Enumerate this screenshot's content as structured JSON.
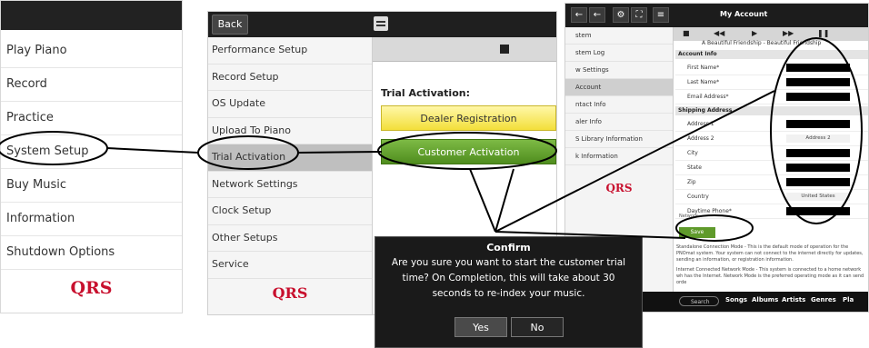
{
  "panel1": {
    "menu": [
      "Play Piano",
      "Record",
      "Practice",
      "System Setup",
      "Buy Music",
      "Information",
      "Shutdown Options"
    ],
    "logo": "QRS"
  },
  "panel2": {
    "back_label": "Back",
    "sidebar": [
      "Performance Setup",
      "Record Setup",
      "OS Update",
      "Upload To Piano",
      "Trial Activation",
      "Network Settings",
      "Clock Setup",
      "Other Setups",
      "Service"
    ],
    "logo": "QRS",
    "heading": "Trial Activation:",
    "dealer_button": "Dealer Registration",
    "customer_button": "Customer Activation"
  },
  "dialog": {
    "title": "Confirm",
    "message": "Are you sure you want to start the customer trial time? On Completion, this will take about 30 seconds to re-index your music.",
    "yes": "Yes",
    "no": "No"
  },
  "panel3": {
    "title": "My Account",
    "song": "A Beautiful Friendship - Beautiful Friendship",
    "sidebar": [
      "stem",
      "stem Log",
      "w Settings",
      "Account",
      "ntact Info",
      "aler Info",
      "S Library Information",
      "k Information"
    ],
    "logo": "QRS",
    "sections": {
      "account": "Account Info",
      "shipping": "Shipping Address"
    },
    "fields": {
      "first_name": "First Name*",
      "last_name": "Last Name*",
      "email": "Email Address*",
      "address1": "Address 1",
      "address2": "Address 2",
      "address2_value": "Address 2",
      "city": "City",
      "state": "State",
      "zip": "Zip",
      "country": "Country",
      "country_value": "United States",
      "phone": "Daytime Phone*"
    },
    "network_label": "Network",
    "save": "Save",
    "para1": "Standalone Connection Mode - This is the default mode of operation for the PNOmat system. Your system can not connect to the internet directly for updates, sending an information, or registration information.",
    "para2": "Internet Connected Network Mode - This system is connected to a home network wh has the Internet. Network Mode is the preferred operating mode as it can send orde",
    "bottom": {
      "search": "Search",
      "songs": "Songs",
      "albums": "Albums",
      "artists": "Artists",
      "genres": "Genres",
      "pla": "Pla"
    }
  }
}
